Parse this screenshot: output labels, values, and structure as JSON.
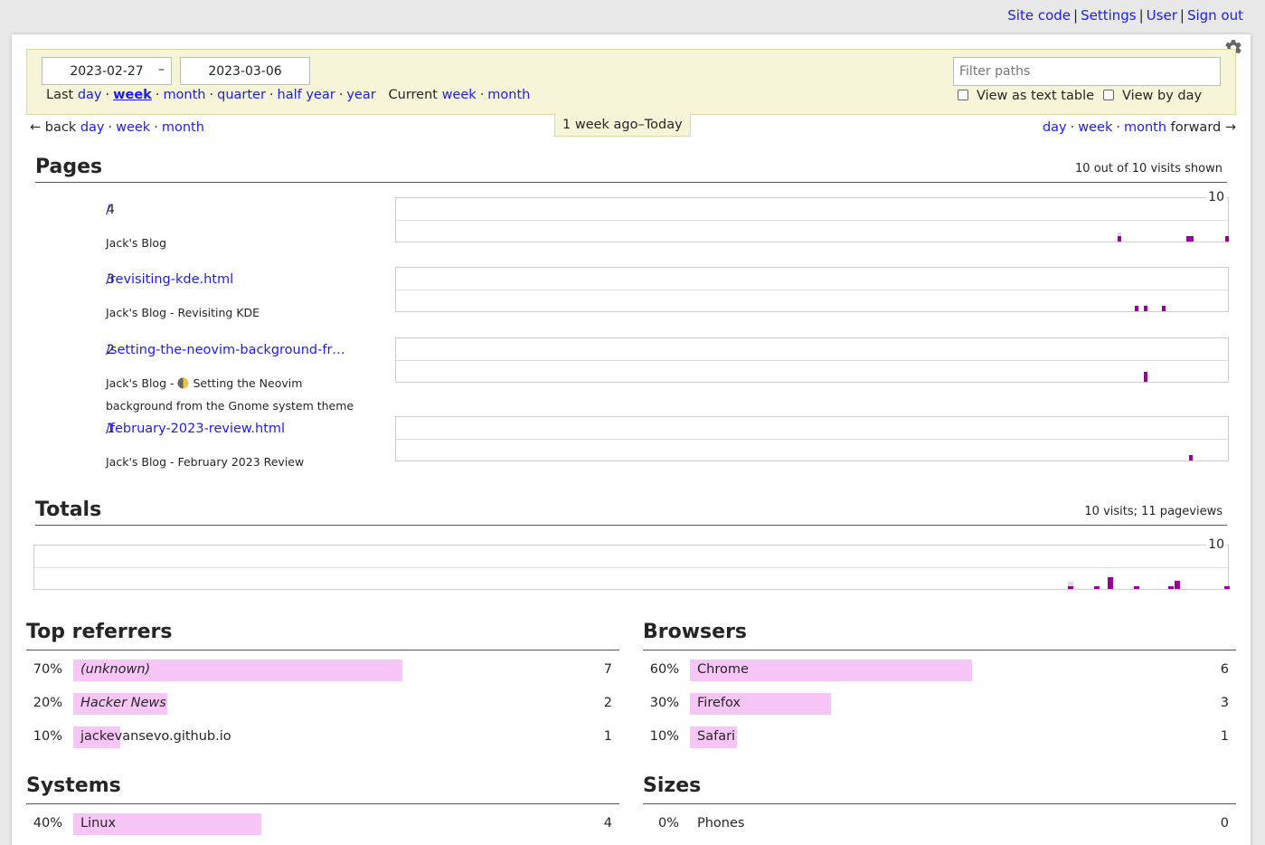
{
  "topnav": {
    "site_code": "Site code",
    "settings": "Settings",
    "user": "User",
    "sign_out": "Sign out"
  },
  "filter": {
    "date_start": "2023-02-27",
    "date_end": "2023-03-06",
    "date_sep": "–",
    "last_label": "Last",
    "last_periods": [
      "day",
      "week",
      "month",
      "quarter",
      "half year",
      "year"
    ],
    "current_label": "Current",
    "current_periods": [
      "week",
      "month"
    ],
    "filter_placeholder": "Filter paths",
    "view_text_table": "View as text table",
    "view_by_day": "View by day"
  },
  "period_label": "1 week ago–Today",
  "backnav": {
    "arrow": "← back",
    "day": "day",
    "week": "week",
    "month": "month"
  },
  "fwdnav": {
    "day": "day",
    "week": "week",
    "month": "month",
    "forward": "forward →"
  },
  "pages": {
    "title": "Pages",
    "meta": "10 out of 10 visits shown",
    "max_label": "10",
    "rows": [
      {
        "count": "4",
        "path": "/",
        "title": "Jack's Blog",
        "bars": [
          {
            "pos": 0.867,
            "h": 0.28,
            "g": 0.5
          },
          {
            "pos": 0.95,
            "h": 0.28
          },
          {
            "pos": 0.954,
            "h": 0.28
          },
          {
            "pos": 0.997,
            "h": 0.28
          }
        ]
      },
      {
        "count": "3",
        "path": "/revisiting-kde.html",
        "title": "Jack's Blog - Revisiting KDE",
        "bars": [
          {
            "pos": 0.888,
            "h": 0.28
          },
          {
            "pos": 0.899,
            "h": 0.28
          },
          {
            "pos": 0.921,
            "h": 0.28
          }
        ]
      },
      {
        "count": "2",
        "path": "/setting-the-neovim-background-fro...",
        "title_prefix": "Jack's Blog - ",
        "title_suffix": "Setting the Neovim background from the Gnome system theme",
        "bars": [
          {
            "pos": 0.899,
            "h": 0.55
          }
        ]
      },
      {
        "count": "1",
        "path": "/february-2023-review.html",
        "title": "Jack's Blog - February 2023 Review",
        "bars": [
          {
            "pos": 0.953,
            "h": 0.28
          }
        ]
      }
    ]
  },
  "totals": {
    "title": "Totals",
    "meta": "10 visits; 11 pageviews",
    "max_label": "10",
    "bars": [
      {
        "pos": 0.866,
        "h": 0.14,
        "g": 0.35
      },
      {
        "pos": 0.888,
        "h": 0.14
      },
      {
        "pos": 0.899,
        "h": 0.55
      },
      {
        "pos": 0.921,
        "h": 0.14
      },
      {
        "pos": 0.95,
        "h": 0.14
      },
      {
        "pos": 0.955,
        "h": 0.38
      },
      {
        "pos": 0.997,
        "h": 0.14
      }
    ]
  },
  "referrers": {
    "title": "Top referrers",
    "rows": [
      {
        "pct": "70%",
        "label": "(unknown)",
        "num": "7",
        "frac": 0.7,
        "italic": true
      },
      {
        "pct": "20%",
        "label": "Hacker News",
        "num": "2",
        "frac": 0.2,
        "italic": true
      },
      {
        "pct": "10%",
        "label": "jackevansevo.github.io",
        "num": "1",
        "frac": 0.1,
        "italic": false
      }
    ]
  },
  "browsers": {
    "title": "Browsers",
    "rows": [
      {
        "pct": "60%",
        "label": "Chrome",
        "num": "6",
        "frac": 0.6
      },
      {
        "pct": "30%",
        "label": "Firefox",
        "num": "3",
        "frac": 0.3
      },
      {
        "pct": "10%",
        "label": "Safari",
        "num": "1",
        "frac": 0.1
      }
    ]
  },
  "systems": {
    "title": "Systems",
    "rows": [
      {
        "pct": "40%",
        "label": "Linux",
        "num": "4",
        "frac": 0.4
      }
    ]
  },
  "sizes": {
    "title": "Sizes",
    "rows": [
      {
        "pct": "0%",
        "label": "Phones",
        "num": "0",
        "frac": 0.0
      }
    ]
  }
}
